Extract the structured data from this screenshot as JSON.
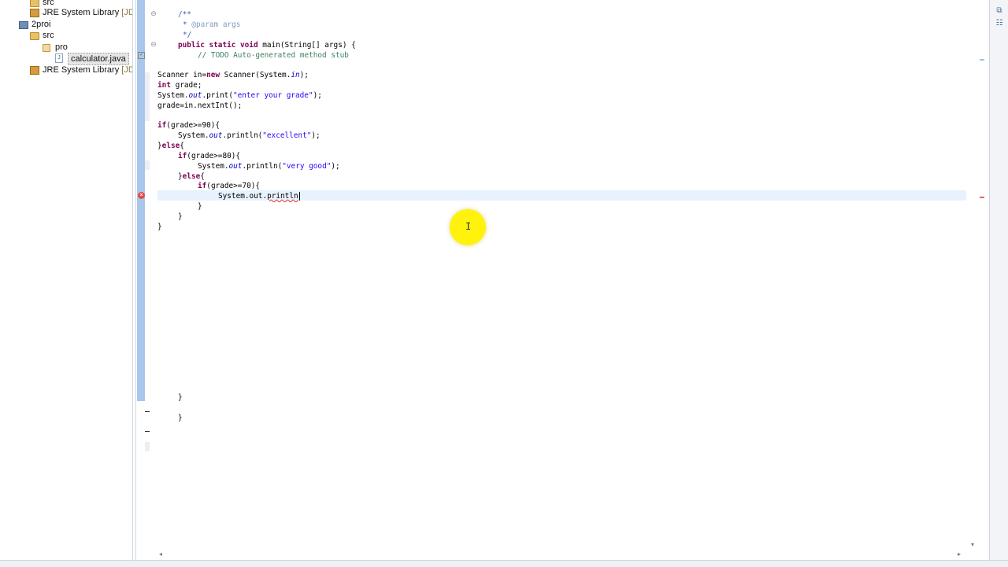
{
  "explorer": {
    "items": [
      {
        "label": "src",
        "tag": "",
        "indent": 1
      },
      {
        "label": "JRE System Library",
        "tag": "[JDK]",
        "indent": 1
      },
      {
        "label": "2proi",
        "tag": "",
        "indent": 0
      },
      {
        "label": "src",
        "tag": "",
        "indent": 1
      },
      {
        "label": "pro",
        "tag": "",
        "indent": 2
      },
      {
        "label": "calculator.java",
        "tag": "",
        "indent": 3
      },
      {
        "label": "JRE System Library",
        "tag": "[JDK]",
        "indent": 1
      }
    ]
  },
  "editor": {
    "javadoc_open": "/**",
    "javadoc_param_tag": "@param",
    "javadoc_param_name": " args",
    "javadoc_close": "*/",
    "main_kw": "public static void",
    "main_sig": " main(String[] args) {",
    "todo_comment": "// TODO Auto-generated method stub",
    "l_scanner_1": "Scanner in=",
    "l_scanner_kw": "new",
    "l_scanner_2": " Scanner(System.",
    "l_scanner_in": "in",
    "l_scanner_3": ");",
    "l_int_kw": "int",
    "l_int_rest": " grade;",
    "l_print_1": "System.",
    "l_print_out": "out",
    "l_print_2": ".print(",
    "l_print_str": "\"enter your grade\"",
    "l_print_3": ");",
    "l_next": "grade=in.nextInt();",
    "l_if90_kw": "if",
    "l_if90_rest": "(grade>=90){",
    "l_exc_1": "System.",
    "l_exc_out": "out",
    "l_exc_2": ".println(",
    "l_exc_str": "\"excellent\"",
    "l_exc_3": ");",
    "l_else1_1": "}",
    "l_else1_kw": "else",
    "l_else1_2": "{",
    "l_if80_kw": "if",
    "l_if80_rest": "(grade>=80){",
    "l_vg_1": "System.",
    "l_vg_out": "out",
    "l_vg_2": ".println(",
    "l_vg_str": "\"very good\"",
    "l_vg_3": ");",
    "l_else2_1": "}",
    "l_else2_kw": "else",
    "l_else2_2": "{",
    "l_if70_kw": "if",
    "l_if70_rest": "(grade>=70){",
    "l_cur_1": "System.out.",
    "l_cur_err": "println",
    "brace": "}"
  },
  "colors": {
    "keyword": "#7f0055",
    "comment": "#3f7f5f",
    "string": "#2a00ff",
    "field": "#0000c0",
    "current_line": "#e8f2fe",
    "error": "#e54848",
    "cursor_highlight": "#fff200"
  },
  "icons": {
    "error_marker": "error-icon",
    "cursor": "ibeam-cursor-icon"
  }
}
